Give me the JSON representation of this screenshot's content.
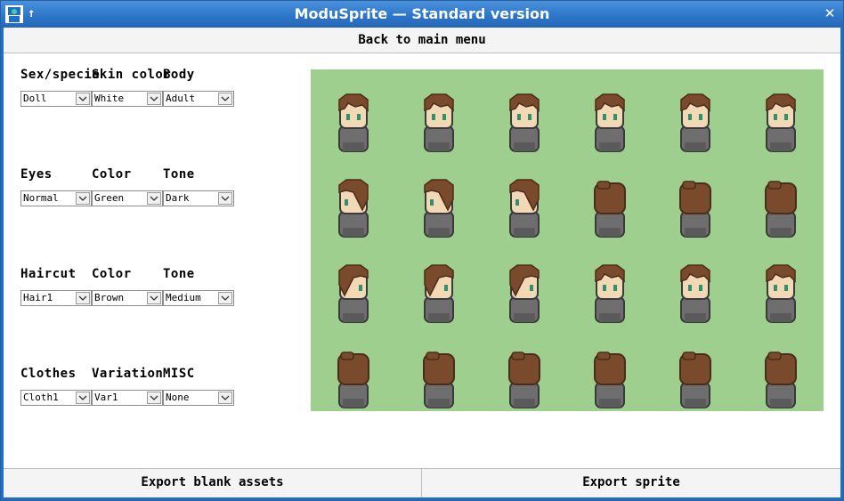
{
  "window": {
    "title": "ModuSprite — Standard version"
  },
  "top_button": "Back to main menu",
  "groups": [
    {
      "labels": [
        "Sex/specie",
        "Skin color",
        "Body"
      ],
      "values": [
        "Doll",
        "White",
        "Adult"
      ]
    },
    {
      "labels": [
        "Eyes",
        "Color",
        "Tone"
      ],
      "values": [
        "Normal",
        "Green",
        "Dark"
      ]
    },
    {
      "labels": [
        "Haircut",
        "Color",
        "Tone"
      ],
      "values": [
        "Hair1",
        "Brown",
        "Medium"
      ]
    },
    {
      "labels": [
        "Clothes",
        "Variation",
        "MISC"
      ],
      "values": [
        "Cloth1",
        "Var1",
        "None"
      ]
    }
  ],
  "bottom_buttons": {
    "left": "Export blank assets",
    "right": "Export sprite"
  },
  "colors": {
    "preview_bg": "#9ecf8e",
    "hair": "#7a4a2c",
    "skin": "#f3d8b6",
    "body": "#6e6e6e",
    "eyes": "#2f8f6f"
  },
  "sprite_rows": [
    [
      "front",
      "front",
      "front",
      "front",
      "front",
      "front"
    ],
    [
      "side-left",
      "side-left",
      "side-left",
      "back",
      "back",
      "back"
    ],
    [
      "side-right",
      "side-right",
      "side-right",
      "front",
      "front",
      "front"
    ],
    [
      "back",
      "back",
      "back",
      "back",
      "back",
      "back"
    ]
  ]
}
